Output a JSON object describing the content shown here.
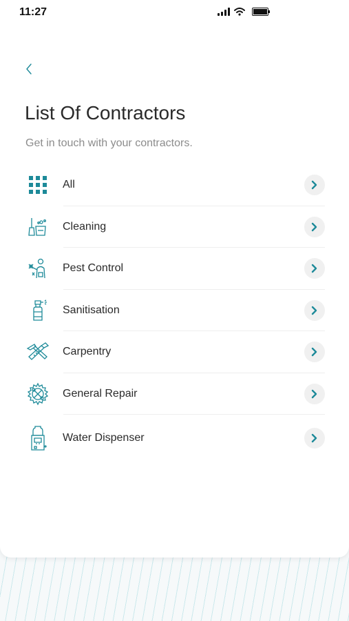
{
  "status_bar": {
    "time": "11:27"
  },
  "header": {
    "title": "List Of Contractors",
    "subtitle": "Get in touch with your contractors."
  },
  "colors": {
    "accent": "#1d8a99",
    "chevron_bg": "#f0f0f0"
  },
  "contractors": [
    {
      "label": "All",
      "icon": "grid-icon"
    },
    {
      "label": "Cleaning",
      "icon": "cleaning-icon"
    },
    {
      "label": "Pest Control",
      "icon": "pest-control-icon"
    },
    {
      "label": "Sanitisation",
      "icon": "sanitiser-spray-icon"
    },
    {
      "label": "Carpentry",
      "icon": "carpentry-tools-icon"
    },
    {
      "label": "General Repair",
      "icon": "gear-wrench-icon"
    },
    {
      "label": "Water Dispenser",
      "icon": "water-dispenser-icon"
    }
  ]
}
